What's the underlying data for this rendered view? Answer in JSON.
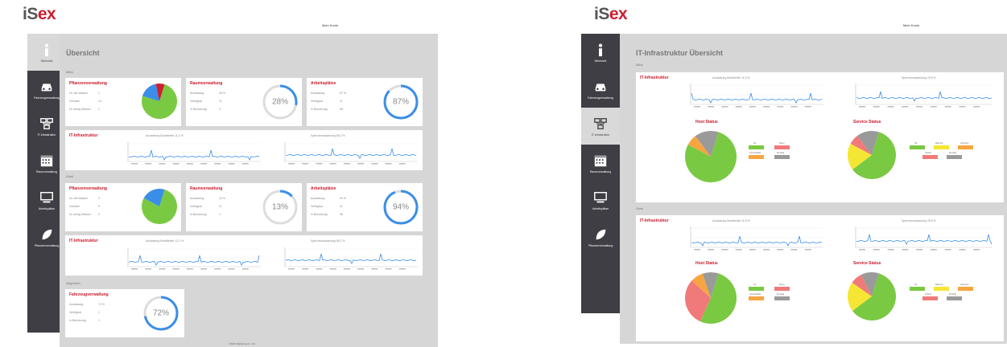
{
  "left": {
    "logo": "iSEX",
    "user": "Mein Konto",
    "nav": [
      "Übersicht",
      "Fahrzeugverwaltung",
      "IT-Infrastruktur",
      "Raumverwaltung",
      "Arbeitsplätze",
      "Pflanzenverwaltung"
    ],
    "page_title": "Übersicht",
    "sections": [
      "Bilbo",
      "Gimli",
      "Allgemein"
    ],
    "cards": [
      {
        "title": "Pflanzenverwaltung",
        "rows": [
          [
            "Zu viel Wasser",
            "1"
          ],
          [
            "Vorhabn",
            "14"
          ],
          [
            "Zu wenig Wasser",
            "1"
          ]
        ]
      },
      {
        "title": "Raumverwaltung",
        "rows": [
          [
            "Auslastung",
            "28 %"
          ],
          [
            "Verfügbar",
            "11"
          ],
          [
            "In Benutzung",
            "3"
          ]
        ],
        "percent": "28%",
        "fraction": 0.28
      },
      {
        "title": "Arbeitsplätze",
        "rows": [
          [
            "Auslastung",
            "87 %"
          ],
          [
            "Verfügbar",
            "11"
          ],
          [
            "In Benutzung",
            "96"
          ]
        ],
        "percent": "87%",
        "fraction": 0.87
      },
      {
        "title": "Pflanzenverwaltung",
        "rows": [
          [
            "Zu viel Wasser",
            "2"
          ],
          [
            "Vorhabn",
            "9"
          ],
          [
            "Zu wenig Wasser",
            "0"
          ]
        ]
      },
      {
        "title": "Raumverwaltung",
        "rows": [
          [
            "Auslastung",
            "13 %"
          ],
          [
            "Verfügbar",
            "11"
          ],
          [
            "In Benutzung",
            "1"
          ]
        ],
        "percent": "13%",
        "fraction": 0.13
      },
      {
        "title": "Arbeitsplätze",
        "rows": [
          [
            "Auslastung",
            "94 %"
          ],
          [
            "Verfügbar",
            "11"
          ],
          [
            "In Benutzung",
            "96"
          ]
        ],
        "percent": "94%",
        "fraction": 0.94
      },
      {
        "title": "Fahrzeugverwaltung",
        "rows": [
          [
            "Auslastung",
            "72 %"
          ],
          [
            "Verfügbar",
            "1"
          ],
          [
            "In Benutzung",
            "1"
          ]
        ],
        "percent": "72%",
        "fraction": 0.72
      }
    ],
    "it_title": "IT-Infrastruktur",
    "it_chart_titles": [
      "Auslastung Bandbreite 11.2 %",
      "Speicherauslastung 58.2 %",
      "Auslastung Bandbreite 12.1 %",
      "Speicherauslastung 58.2 %"
    ],
    "footer": "©2015 Digital Ag Co. AG"
  },
  "right": {
    "logo": "iSEX",
    "user": "Mein Konto",
    "nav": [
      "Übersicht",
      "Fahrzeugverwaltung",
      "IT-Infrastruktur",
      "Raumverwaltung",
      "Arbeitsplätze",
      "Pflanzenverwaltung"
    ],
    "page_title": "IT-Infrastruktur Übersicht",
    "sections": [
      "Bilbo",
      "Gimli"
    ],
    "it_title": "IT-Infrastruktur",
    "chart_titles": [
      "Auslastung Bandbreite 11.5 %",
      "Speicherauslastung 78.5 %",
      "Auslastung Bandbreite 11.5 %",
      "Speicherauslastung 78.5 %"
    ],
    "host_status": "Host Status",
    "service_status": "Service Status",
    "host_legend": [
      "Up",
      "Down",
      "Unreachable",
      "Pending"
    ],
    "service_legend": [
      "Ok",
      "Warning",
      "Unknown",
      "Critical",
      "Pending"
    ]
  },
  "colors": {
    "sidebar": "#3e3e44",
    "accent_red": "#c8192a",
    "ok_green": "#7ac943",
    "blue": "#3b8ee8"
  },
  "pies": {
    "left1": [
      0.75,
      0.17,
      0.08
    ],
    "left2": [
      0.78,
      0.22
    ],
    "host1": [
      0.78,
      0.07,
      0.15
    ],
    "service1": [
      0.6,
      0.18,
      0.07,
      0.15
    ],
    "host2": [
      0.52,
      0.3,
      0.08,
      0.1
    ],
    "service2": [
      0.6,
      0.2,
      0.08,
      0.12
    ]
  }
}
